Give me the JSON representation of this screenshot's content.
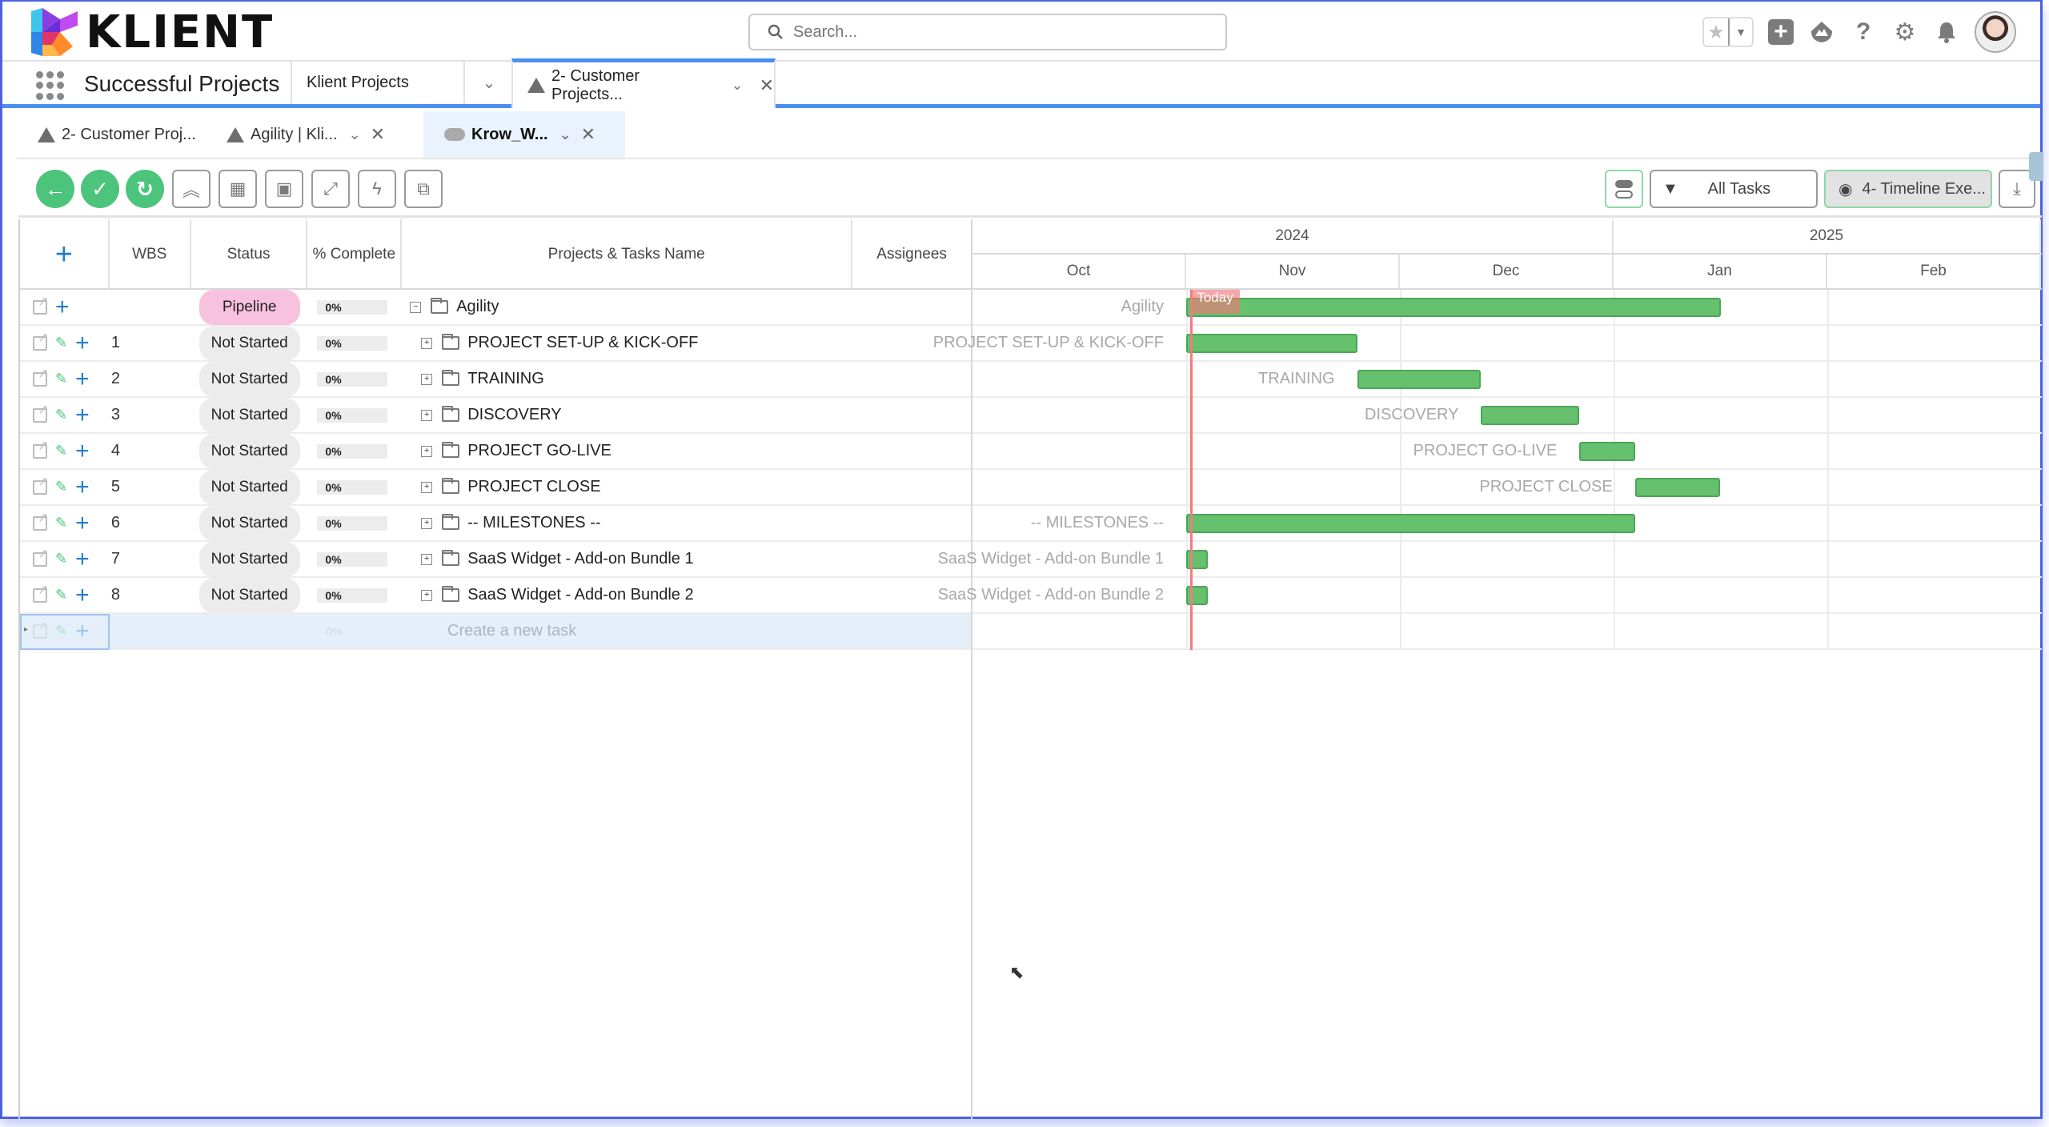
{
  "app": {
    "logo_text": "KLIENT",
    "app_name": "Successful Projects",
    "search_placeholder": "Search..."
  },
  "top_icons": [
    "favorite-star-icon",
    "favorites-dropdown-icon",
    "global-add-icon",
    "trailhead-icon",
    "help-icon",
    "setup-gear-icon",
    "notifications-bell-icon",
    "user-avatar"
  ],
  "nav": {
    "items": [
      {
        "label": "Klient Projects"
      },
      {
        "label": "2- Customer Projects...",
        "active": true
      }
    ]
  },
  "subtabs": [
    {
      "label": "2- Customer Proj...",
      "icon": "triangle-icon"
    },
    {
      "label": "Agility | Kli...",
      "icon": "triangle-icon"
    },
    {
      "label": "Krow_W...",
      "icon": "cloud-icon",
      "active": true
    }
  ],
  "toolbar": {
    "left_buttons": [
      "back",
      "save",
      "refresh",
      "collapse-all",
      "calendar",
      "presentation",
      "fullscreen",
      "quick-action",
      "open-external"
    ],
    "filter_label": "All Tasks",
    "view_label": "4- Timeline Exe..."
  },
  "grid": {
    "columns": [
      "",
      "WBS",
      "Status",
      "% Complete",
      "Projects & Tasks Name",
      "Assignees"
    ],
    "rows": [
      {
        "wbs": "",
        "status": "Pipeline",
        "status_color": "#f8c1df",
        "pct": "0%",
        "name": "Agility",
        "level": 0,
        "expanded": true
      },
      {
        "wbs": "1",
        "status": "Not Started",
        "status_color": "#ececec",
        "pct": "0%",
        "name": "PROJECT SET-UP & KICK-OFF",
        "level": 1
      },
      {
        "wbs": "2",
        "status": "Not Started",
        "status_color": "#ececec",
        "pct": "0%",
        "name": "TRAINING",
        "level": 1
      },
      {
        "wbs": "3",
        "status": "Not Started",
        "status_color": "#ececec",
        "pct": "0%",
        "name": "DISCOVERY",
        "level": 1
      },
      {
        "wbs": "4",
        "status": "Not Started",
        "status_color": "#ececec",
        "pct": "0%",
        "name": "PROJECT GO-LIVE",
        "level": 1
      },
      {
        "wbs": "5",
        "status": "Not Started",
        "status_color": "#ececec",
        "pct": "0%",
        "name": "PROJECT CLOSE",
        "level": 1
      },
      {
        "wbs": "6",
        "status": "Not Started",
        "status_color": "#ececec",
        "pct": "0%",
        "name": "-- MILESTONES --",
        "level": 1
      },
      {
        "wbs": "7",
        "status": "Not Started",
        "status_color": "#ececec",
        "pct": "0%",
        "name": "SaaS Widget - Add-on Bundle 1",
        "level": 1
      },
      {
        "wbs": "8",
        "status": "Not Started",
        "status_color": "#ececec",
        "pct": "0%",
        "name": "SaaS Widget - Add-on Bundle 2",
        "level": 1
      }
    ],
    "new_row": {
      "pct": "0%",
      "placeholder": "Create a new task"
    }
  },
  "gantt": {
    "years": [
      {
        "label": "2024",
        "span": [
          "Oct",
          "Dec"
        ]
      },
      {
        "label": "2025",
        "span": [
          "Jan",
          "Feb"
        ]
      }
    ],
    "months": [
      "Oct",
      "Nov",
      "Dec",
      "Jan",
      "Feb"
    ],
    "today_label": "Today",
    "today_month_offset": 1.02,
    "bar_color": "#66c16f",
    "bars": [
      {
        "label": "Agility",
        "start": 1.0,
        "end": 3.5
      },
      {
        "label": "PROJECT SET-UP & KICK-OFF",
        "start": 1.0,
        "end": 1.8
      },
      {
        "label": "TRAINING",
        "start": 1.8,
        "end": 2.38
      },
      {
        "label": "DISCOVERY",
        "start": 2.38,
        "end": 2.84
      },
      {
        "label": "PROJECT GO-LIVE",
        "start": 2.84,
        "end": 3.1
      },
      {
        "label": "PROJECT CLOSE",
        "start": 3.1,
        "end": 3.5
      },
      {
        "label": "-- MILESTONES --",
        "start": 1.0,
        "end": 3.1
      },
      {
        "label": "SaaS Widget - Add-on Bundle 1",
        "start": 1.0,
        "end": 1.1
      },
      {
        "label": "SaaS Widget - Add-on Bundle 2",
        "start": 1.0,
        "end": 1.1
      }
    ]
  }
}
